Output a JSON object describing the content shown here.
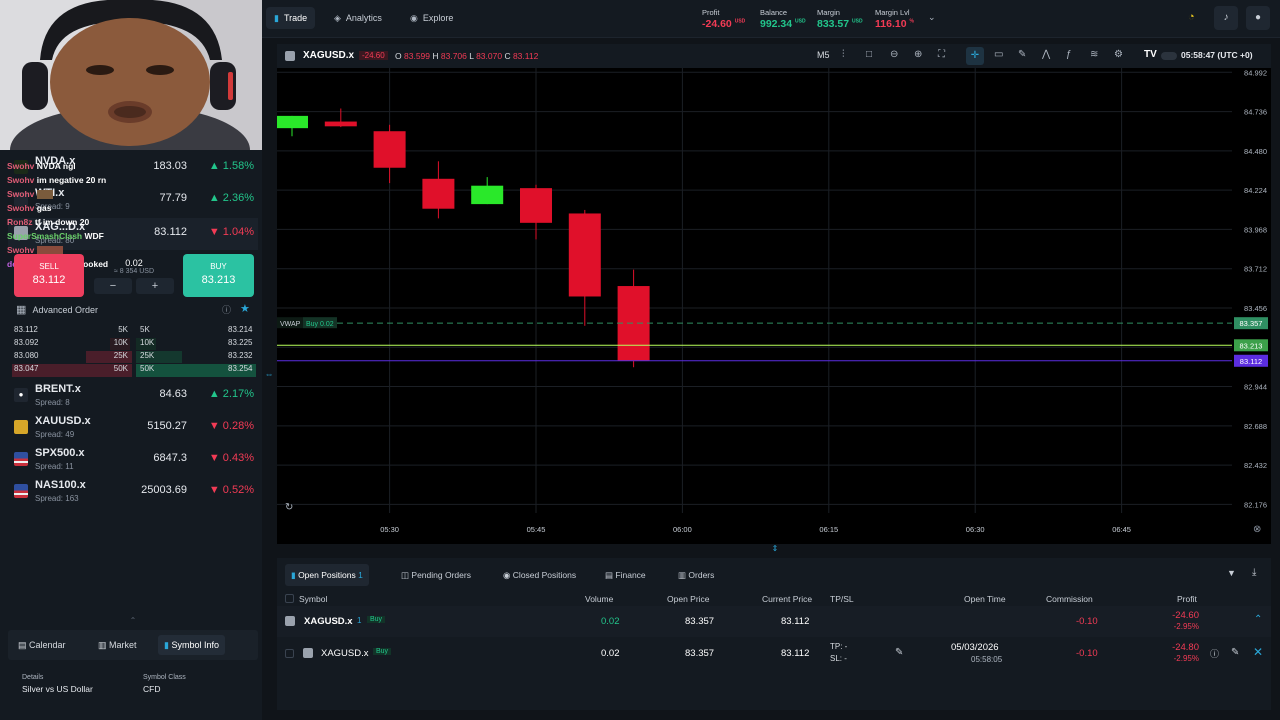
{
  "nav": {
    "trade": "Trade",
    "analytics": "Analytics",
    "explore": "Explore"
  },
  "account": {
    "profit": {
      "label": "Profit",
      "value": "-24.60",
      "unit": "USD"
    },
    "balance": {
      "label": "Balance",
      "value": "992.34",
      "unit": "USD"
    },
    "margin": {
      "label": "Margin",
      "value": "833.57",
      "unit": "USD"
    },
    "margin_lvl": {
      "label": "Margin Lvl",
      "value": "116.10",
      "unit": "%"
    }
  },
  "watchlist": [
    {
      "symbol": "NVDA.x",
      "spread": "",
      "price": "183.03",
      "change": "1.58%",
      "dir": "up"
    },
    {
      "symbol": "WTI.x",
      "spread": "Spread: 9",
      "price": "77.79",
      "change": "2.36%",
      "dir": "up"
    },
    {
      "symbol": "XAG...D.x",
      "spread": "Spread: 80",
      "price": "83.112",
      "change": "1.04%",
      "dir": "down"
    },
    {
      "symbol": "BRENT.x",
      "spread": "Spread: 8",
      "price": "84.63",
      "change": "2.17%",
      "dir": "up"
    },
    {
      "symbol": "XAUUSD.x",
      "spread": "Spread: 49",
      "price": "5150.27",
      "change": "0.28%",
      "dir": "down"
    },
    {
      "symbol": "SPX500.x",
      "spread": "Spread: 11",
      "price": "6847.3",
      "change": "0.43%",
      "dir": "down"
    },
    {
      "symbol": "NAS100.x",
      "spread": "Spread: 163",
      "price": "25003.69",
      "change": "0.52%",
      "dir": "down"
    }
  ],
  "chat": [
    {
      "user": "Swohv",
      "msg": "NVDA ngl",
      "color": "#e05d76"
    },
    {
      "user": "Swohv",
      "msg": "im negative 20 rn",
      "color": "#e05d76"
    },
    {
      "user": "Swohv",
      "msg": "",
      "color": "#e05d76"
    },
    {
      "user": "Swohv",
      "msg": "gas",
      "color": "#e05d76"
    },
    {
      "user": "Ron8z",
      "msg": "tf im down 20",
      "color": "#e05d76"
    },
    {
      "user": "SuperSmashClash",
      "msg": "WDF",
      "color": "#6ad06a"
    },
    {
      "user": "Swohv",
      "msg": "",
      "color": "#e05d76"
    },
    {
      "user": "deepitahardz",
      "msg": "yall cooked",
      "color": "#c060e0"
    }
  ],
  "trade_widget": {
    "sell_label": "SELL",
    "sell_price": "83.112",
    "buy_label": "BUY",
    "buy_price": "83.213",
    "volume": "0.02",
    "volume_usd": "≈ 8 354 USD",
    "minus": "−",
    "plus": "+"
  },
  "advanced_order": "Advanced Order",
  "order_book": [
    {
      "bid": "83.112",
      "bvol": "5K",
      "avol": "5K",
      "ask": "83.214"
    },
    {
      "bid": "83.092",
      "bvol": "10K",
      "avol": "10K",
      "ask": "83.225"
    },
    {
      "bid": "83.080",
      "bvol": "25K",
      "avol": "25K",
      "ask": "83.232"
    },
    {
      "bid": "83.047",
      "bvol": "50K",
      "avol": "50K",
      "ask": "83.254"
    }
  ],
  "bottom_tabs": {
    "calendar": "Calendar",
    "market": "Market",
    "symbol_info": "Symbol Info"
  },
  "symbol_info": {
    "details_label": "Details",
    "details_value": "Silver vs US Dollar",
    "class_label": "Symbol Class",
    "class_value": "CFD"
  },
  "chart_header": {
    "symbol": "XAGUSD.x",
    "change": "-24.60",
    "o_label": "O",
    "o": "83.599",
    "h_label": "H",
    "h": "83.706",
    "l_label": "L",
    "l": "83.070",
    "c_label": "C",
    "c": "83.112",
    "timeframe": "M5",
    "clock": "05:58:47 (UTC +0)"
  },
  "chart_data": {
    "type": "candlestick",
    "x": [
      "05:20",
      "05:25",
      "05:30",
      "05:35",
      "05:40",
      "05:45",
      "05:50",
      "05:55"
    ],
    "candles": [
      {
        "o": 84.628,
        "h": 84.656,
        "l": 84.575,
        "c": 84.708
      },
      {
        "o": 84.671,
        "h": 84.756,
        "l": 84.635,
        "c": 84.64
      },
      {
        "o": 84.608,
        "h": 84.65,
        "l": 84.27,
        "c": 84.37
      },
      {
        "o": 84.298,
        "h": 84.412,
        "l": 84.04,
        "c": 84.103
      },
      {
        "o": 84.133,
        "h": 84.309,
        "l": 84.133,
        "c": 84.253
      },
      {
        "o": 84.237,
        "h": 84.259,
        "l": 83.903,
        "c": 84.011
      },
      {
        "o": 84.072,
        "h": 84.095,
        "l": 83.34,
        "c": 83.531
      },
      {
        "o": 83.599,
        "h": 83.706,
        "l": 83.07,
        "c": 83.112
      }
    ],
    "y_ticks": [
      "84.992",
      "84.736",
      "84.480",
      "84.224",
      "83.968",
      "83.712",
      "83.456",
      "83.200",
      "82.944",
      "82.688",
      "82.432",
      "82.176"
    ],
    "x_ticks": [
      "05:30",
      "05:45",
      "06:00",
      "06:15",
      "06:30",
      "06:45"
    ],
    "ylim": [
      82.12,
      85.02
    ],
    "lines": [
      {
        "name": "VWAP",
        "label": "VWAP",
        "tag": "Buy 0.02",
        "value": 83.357,
        "color": "#2f8f62"
      },
      {
        "name": "ask",
        "value": 83.213,
        "color": "#b9ff5a"
      },
      {
        "name": "bid",
        "value": 83.112,
        "color": "#5b2de0"
      }
    ],
    "price_labels": [
      {
        "value": "83.357",
        "color": "#2f8f62"
      },
      {
        "value": "83.213",
        "color": "#3ca04a"
      },
      {
        "value": "83.112",
        "color": "#5b2de0"
      }
    ]
  },
  "positions": {
    "tabs": {
      "open": "Open Positions",
      "open_count": "1",
      "pending": "Pending Orders",
      "closed": "Closed Positions",
      "finance": "Finance",
      "orders": "Orders"
    },
    "headers": {
      "symbol": "Symbol",
      "volume": "Volume",
      "open_price": "Open Price",
      "current_price": "Current Price",
      "tpsl": "TP/SL",
      "open_time": "Open Time",
      "commission": "Commission",
      "profit": "Profit"
    },
    "group": {
      "symbol": "XAGUSD.x",
      "count": "1",
      "side": "Buy",
      "volume": "0.02",
      "open_price": "83.357",
      "current_price": "83.112",
      "commission": "-0.10",
      "profit": "-24.60",
      "profit_pct": "-2.95%"
    },
    "row": {
      "symbol": "XAGUSD.x",
      "side": "Buy",
      "volume": "0.02",
      "open_price": "83.357",
      "current_price": "83.112",
      "tp": "TP: -",
      "sl": "SL: -",
      "date": "05/03/2026",
      "time": "05:58:05",
      "commission": "-0.10",
      "profit": "-24.80",
      "profit_pct": "-2.95%"
    }
  },
  "colors": {
    "up": "#22c58b",
    "down": "#f23b55",
    "candle_up": "#2ae82a",
    "candle_down": "#e0102a",
    "accent": "#2aa7d8"
  }
}
